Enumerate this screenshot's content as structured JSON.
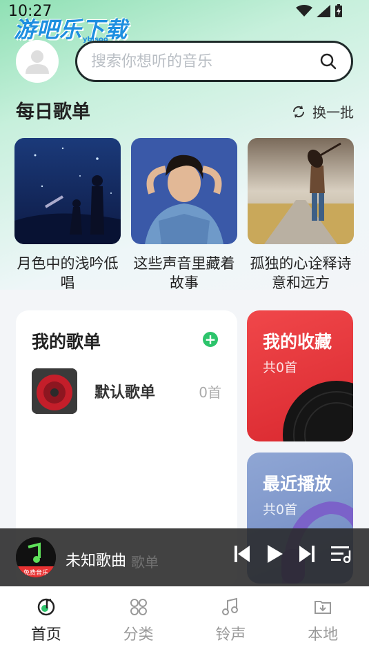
{
  "status_bar": {
    "time": "10:27"
  },
  "watermark": {
    "text": "游吧乐下载",
    "sub": "yblsoo"
  },
  "search": {
    "placeholder": "搜索你想听的音乐"
  },
  "daily": {
    "title": "每日歌单",
    "refresh_label": "换一批",
    "cards": [
      {
        "title": "月色中的浅吟低唱"
      },
      {
        "title": "这些声音里藏着故事"
      },
      {
        "title": "孤独的心诠释诗意和远方"
      }
    ]
  },
  "my_playlists": {
    "title": "我的歌单",
    "items": [
      {
        "name": "默认歌单",
        "count": "0首"
      }
    ],
    "ghost_text": "歌单"
  },
  "favorites": {
    "title": "我的收藏",
    "count": "共0首"
  },
  "recent": {
    "title": "最近播放",
    "count": "共0首"
  },
  "player": {
    "song": "未知歌曲",
    "cover_text": "免费音乐"
  },
  "tabs": [
    {
      "label": "首页",
      "icon": "home-music-icon",
      "active": true
    },
    {
      "label": "分类",
      "icon": "grid-icon",
      "active": false
    },
    {
      "label": "铃声",
      "icon": "music-note-icon",
      "active": false
    },
    {
      "label": "本地",
      "icon": "folder-download-icon",
      "active": false
    }
  ],
  "colors": {
    "accent": "#2cc46b",
    "favorites": "#e8393d",
    "recent": "#7f97cb"
  }
}
